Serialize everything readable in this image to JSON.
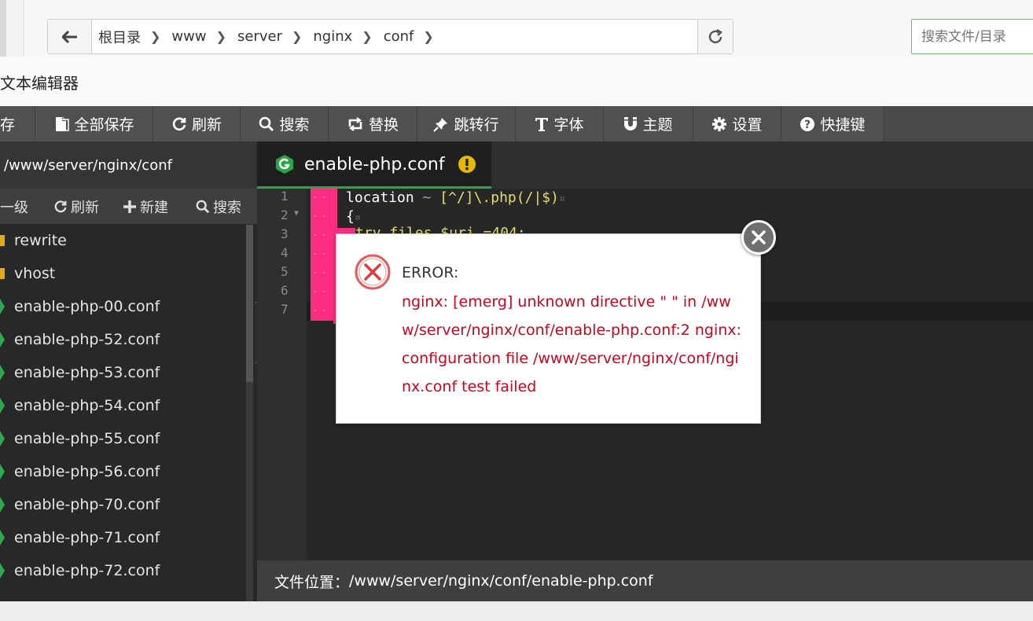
{
  "breadcrumb": [
    "根目录",
    "www",
    "server",
    "nginx",
    "conf"
  ],
  "search": {
    "placeholder": "搜索文件/目录"
  },
  "window": {
    "title": "文本编辑器"
  },
  "toolbar": {
    "items": [
      {
        "label": "存",
        "icon": "save-icon"
      },
      {
        "label": "全部保存",
        "icon": "save-all-icon"
      },
      {
        "label": "刷新",
        "icon": "refresh-icon"
      },
      {
        "label": "搜索",
        "icon": "search-icon"
      },
      {
        "label": "替换",
        "icon": "replace-icon"
      },
      {
        "label": "跳转行",
        "icon": "pin-icon"
      },
      {
        "label": "字体",
        "icon": "font-icon"
      },
      {
        "label": "主题",
        "icon": "magnet-icon"
      },
      {
        "label": "设置",
        "icon": "gear-icon"
      },
      {
        "label": "快捷键",
        "icon": "question-icon"
      }
    ]
  },
  "sidebar": {
    "path": "/www/server/nginx/conf",
    "tools": {
      "up": "一级",
      "refresh": "刷新",
      "new": "新建",
      "search": "搜索"
    },
    "items": [
      {
        "name": "rewrite",
        "type": "folder"
      },
      {
        "name": "vhost",
        "type": "folder"
      },
      {
        "name": "enable-php-00.conf",
        "type": "file"
      },
      {
        "name": "enable-php-52.conf",
        "type": "file"
      },
      {
        "name": "enable-php-53.conf",
        "type": "file"
      },
      {
        "name": "enable-php-54.conf",
        "type": "file"
      },
      {
        "name": "enable-php-55.conf",
        "type": "file"
      },
      {
        "name": "enable-php-56.conf",
        "type": "file"
      },
      {
        "name": "enable-php-70.conf",
        "type": "file"
      },
      {
        "name": "enable-php-71.conf",
        "type": "file"
      },
      {
        "name": "enable-php-72.conf",
        "type": "file"
      }
    ]
  },
  "editor": {
    "tab": "enable-php.conf",
    "line_numbers": [
      "1",
      "2",
      "3",
      "4",
      "5",
      "6",
      "7"
    ],
    "line1": {
      "kw": "location",
      "op": "~",
      "re": "[^/]\\.php(/|$)",
      "pilcrow": "¤"
    },
    "line2": {
      "brace": "{",
      "pilcrow": "¤"
    },
    "line3_fragment": "try_files $uri =404;"
  },
  "status": {
    "label": "文件位置：",
    "path": "/www/server/nginx/conf/enable-php.conf"
  },
  "dialog": {
    "title": "ERROR:",
    "message": "nginx: [emerg] unknown directive \" \" in /www/server/nginx/conf/enable-php.conf:2 nginx: configuration file /www/server/nginx/conf/nginx.conf test failed"
  },
  "colors": {
    "error": "#d0021b",
    "indent_guide": "#ff2d82",
    "tab_accent": "#28a745",
    "warning": "#e6b800"
  }
}
